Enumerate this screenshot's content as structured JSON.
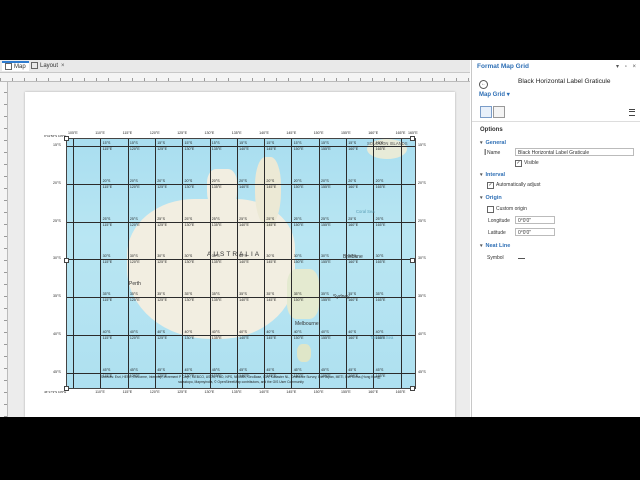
{
  "tabs": [
    {
      "label": "Map"
    },
    {
      "label": "Layout"
    }
  ],
  "map": {
    "top_lon": [
      "105°E",
      "110°E",
      "115°E",
      "120°E",
      "125°E",
      "130°E",
      "135°E",
      "140°E",
      "145°E",
      "150°E",
      "155°E",
      "160°E",
      "165°E"
    ],
    "bottom_lon": [
      "110°E",
      "115°E",
      "120°E",
      "125°E",
      "130°E",
      "135°E",
      "140°E",
      "145°E",
      "150°E",
      "155°E",
      "160°E",
      "165°E"
    ],
    "left_lat": [
      "15°S",
      "20°S",
      "25°S",
      "30°S",
      "35°S",
      "40°S",
      "45°S"
    ],
    "right_lat": [
      "15°S",
      "20°S",
      "25°S",
      "30°S",
      "35°S",
      "40°S",
      "45°S"
    ],
    "inner_lat": [
      "15°S",
      "20°S",
      "25°S",
      "30°S",
      "35°S",
      "40°S",
      "45°S"
    ],
    "inner_lon": [
      "115°E",
      "120°E",
      "125°E",
      "130°E",
      "135°E",
      "140°E",
      "145°E",
      "150°E",
      "155°E",
      "160°E",
      "165°E"
    ],
    "corner_top_left": "9°41'56\"S 105°E",
    "corner_bottom_left": "46°17'3\"S 105°E",
    "corner_right": "165°E",
    "country": "AUSTRALIA",
    "places": [
      "Perth",
      "Brisbane",
      "Sydney",
      "Melbourne"
    ],
    "seas": [
      "Coral Sea",
      "Tasman Sea",
      "SOLOMON ISLANDS"
    ],
    "credits": [
      "Sources: Esri, HERE, DeLorme, Intermap, increment P Corp., GEBCO, USGS, FAO, NPS, NRCAN, GeoBase, IGN, Kadaster NL, Ordnance Survey, Esri Japan, METI, Esri China (Hong Kong),",
      "swisstopo, Mapmyindia, © OpenStreetMap contributors, and the GIS User Community"
    ]
  },
  "pane": {
    "title": "Format Map Grid",
    "element_name": "Black Horizontal Label Graticule",
    "subtitle": "Map Grid",
    "options_label": "Options",
    "general": {
      "header": "General",
      "name_label": "Name",
      "name_value": "Black Horizontal Label Graticule",
      "visible_label": "Visible"
    },
    "interval": {
      "header": "Interval",
      "auto_label": "Automatically adjust"
    },
    "origin": {
      "header": "Origin",
      "custom_label": "Custom origin",
      "longitude_label": "Longitude",
      "longitude_value": "0°0'0\"",
      "latitude_label": "Latitude",
      "latitude_value": "0°0'0\""
    },
    "neatline": {
      "header": "Neat Line",
      "symbol_label": "Symbol"
    }
  }
}
